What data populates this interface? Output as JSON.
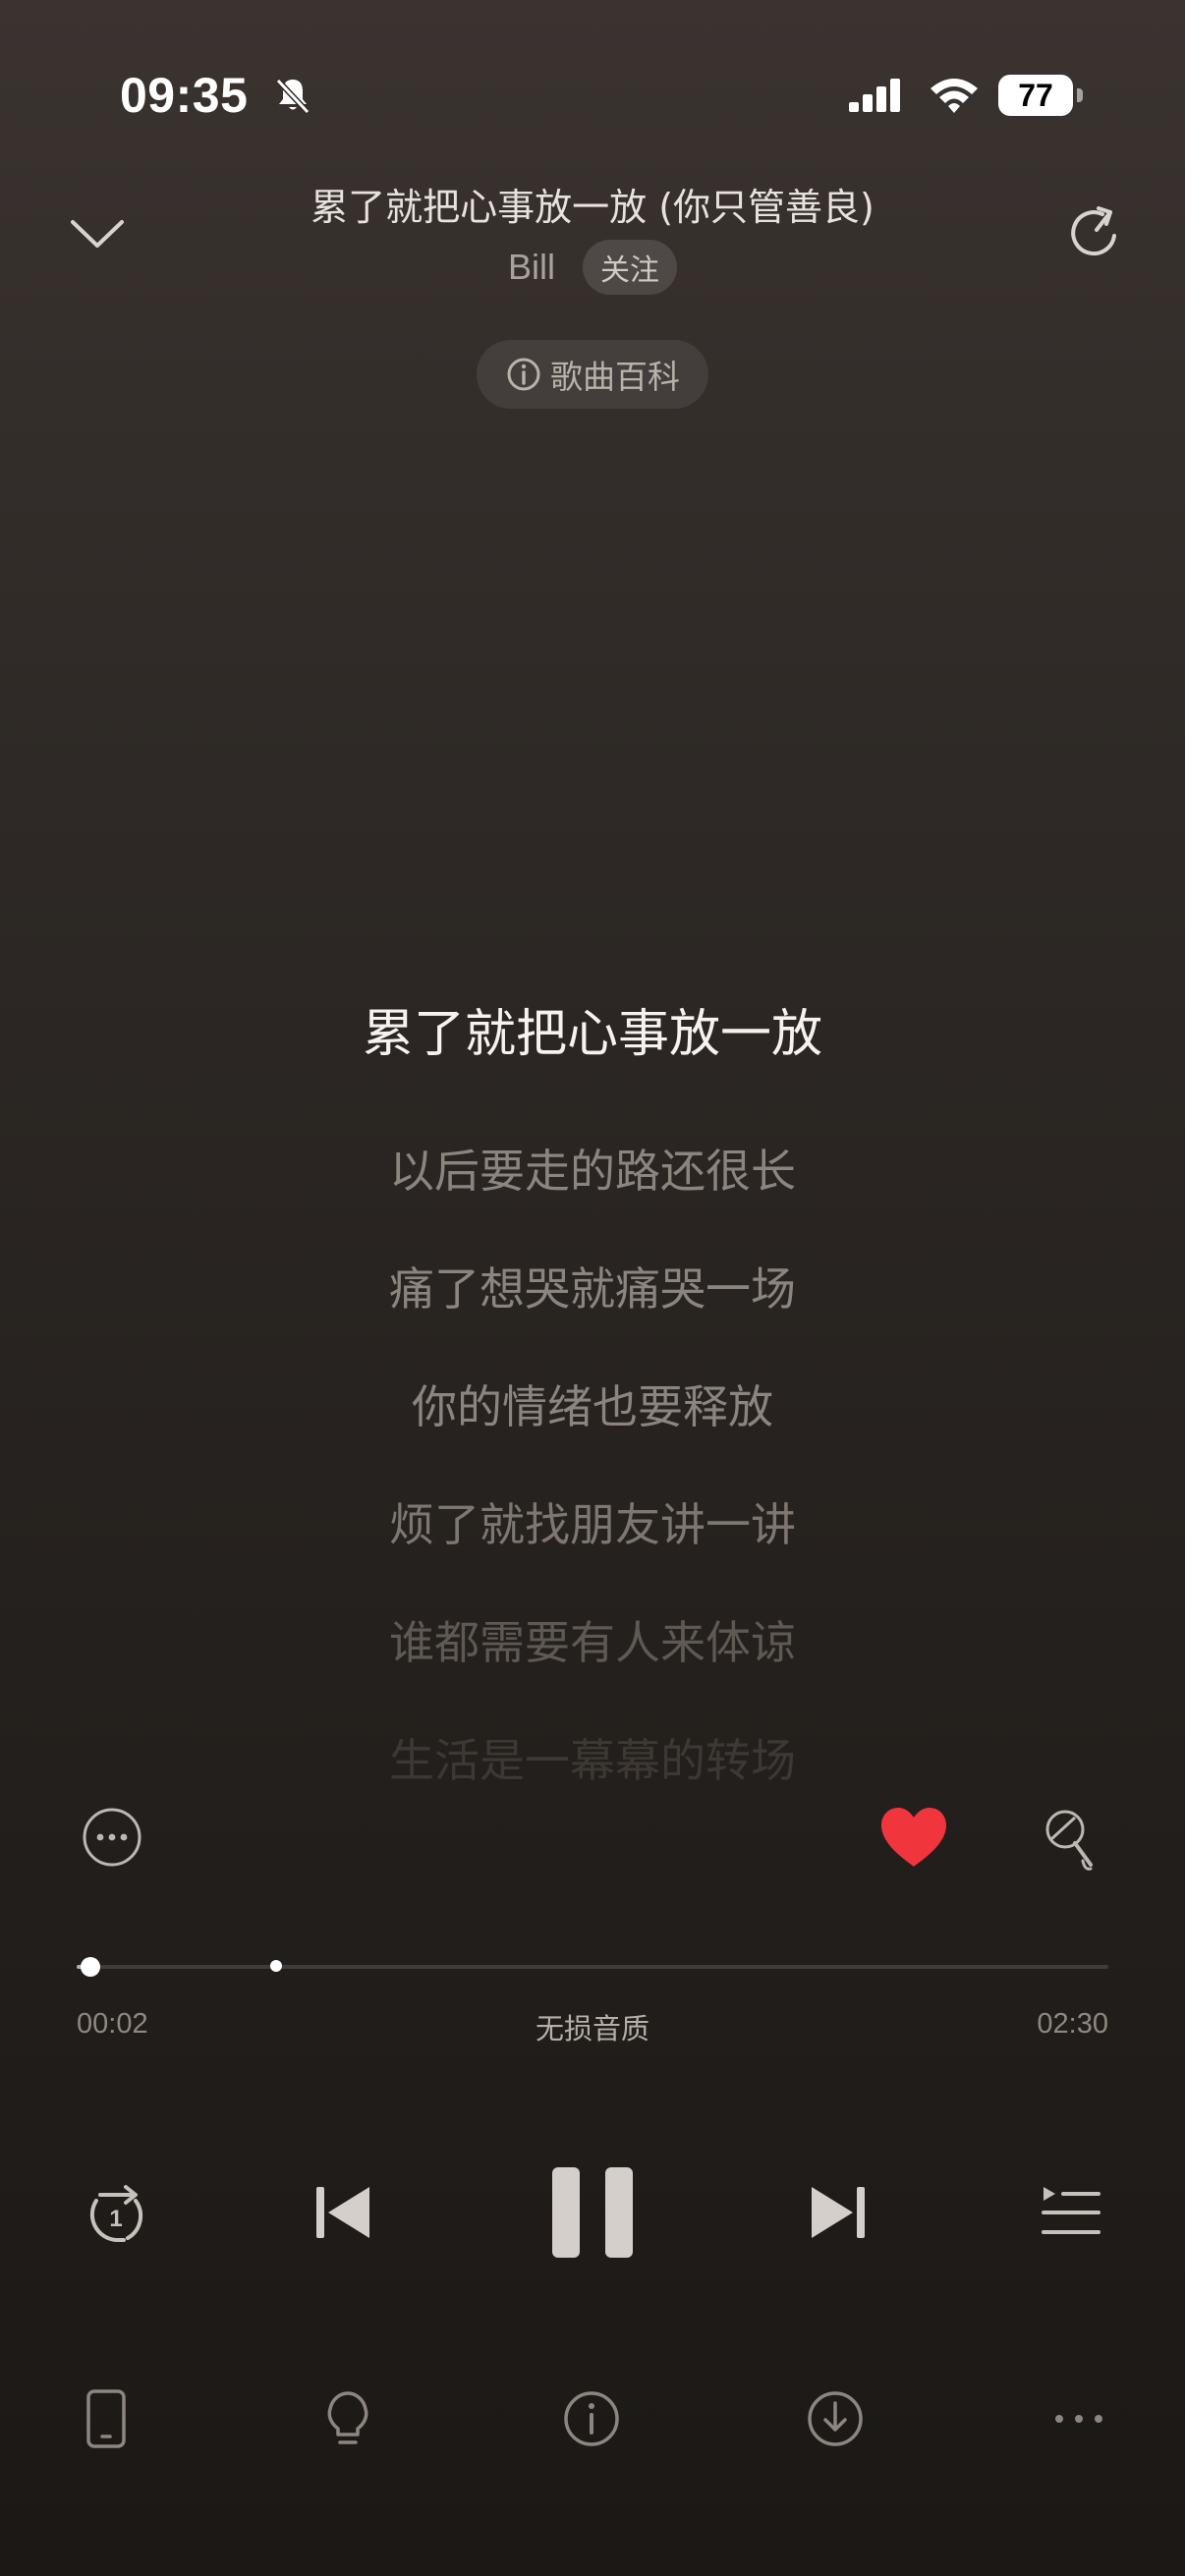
{
  "status_bar": {
    "time": "09:35",
    "battery": "77",
    "icons": [
      "bell-muted-icon",
      "cellular-signal-icon",
      "wifi-icon",
      "battery-icon"
    ]
  },
  "header": {
    "title": "累了就把心事放一放 (你只管善良)",
    "artist": "Bill",
    "follow_label": "关注",
    "wiki_label": "歌曲百科",
    "icons": [
      "chevron-down-icon",
      "share-icon",
      "info-icon"
    ]
  },
  "lyrics": {
    "current": "累了就把心事放一放",
    "upcoming": [
      "以后要走的路还很长",
      "痛了想哭就痛哭一场",
      "你的情绪也要释放",
      "烦了就找朋友讲一讲",
      "谁都需要有人来体谅",
      "生活是一幕幕的转场"
    ]
  },
  "actions": {
    "liked": true,
    "like_color": "#f0353c",
    "icons": [
      "more-circle-icon",
      "heart-icon",
      "microphone-icon"
    ]
  },
  "progress": {
    "elapsed": "00:02",
    "total": "02:30",
    "fraction": 0.013,
    "quality": "无损音质"
  },
  "transport": {
    "repeat_badge": "1",
    "icons": [
      "repeat-one-icon",
      "previous-icon",
      "pause-icon",
      "next-icon",
      "playlist-icon"
    ]
  },
  "toolbar": {
    "icons": [
      "phone-device-icon",
      "lightbulb-icon",
      "info-icon",
      "download-icon",
      "more-dots-icon"
    ]
  }
}
